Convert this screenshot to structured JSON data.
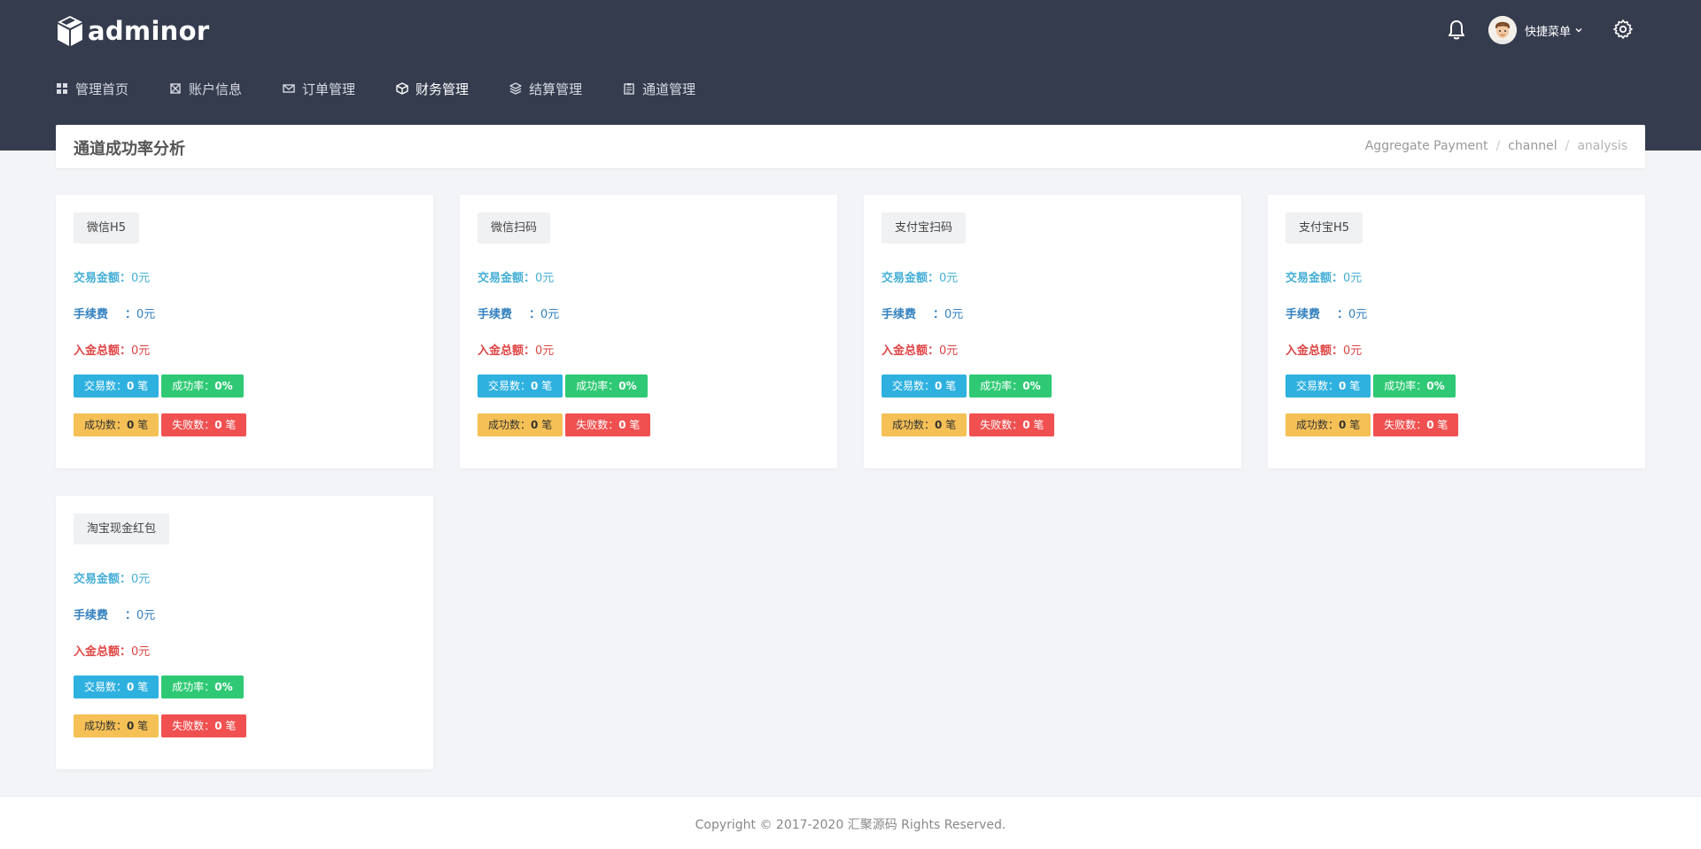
{
  "brand": {
    "name": "adminor"
  },
  "header": {
    "user_menu_label": "快捷菜单"
  },
  "nav": {
    "items": [
      {
        "label": "管理首页",
        "icon": "dashboard-icon",
        "active": false
      },
      {
        "label": "账户信息",
        "icon": "account-icon",
        "active": false
      },
      {
        "label": "订单管理",
        "icon": "mail-icon",
        "active": false
      },
      {
        "label": "财务管理",
        "icon": "cube-icon",
        "active": true
      },
      {
        "label": "结算管理",
        "icon": "layers-icon",
        "active": false
      },
      {
        "label": "通道管理",
        "icon": "clipboard-icon",
        "active": false
      }
    ]
  },
  "page": {
    "title": "通道成功率分析",
    "breadcrumb": [
      "Aggregate Payment",
      "channel",
      "analysis"
    ]
  },
  "labels": {
    "trade_amount": "交易金额：",
    "fee": "手续费",
    "fee_colon": "：",
    "income_total": "入金总额：",
    "trade_count": "交易数：",
    "success_rate": "成功率：",
    "success_count": "成功数：",
    "fail_count": "失败数：",
    "count_unit": "笔"
  },
  "channels": [
    {
      "name": "微信H5",
      "trade_amount": "0元",
      "fee": "0元",
      "income_total": "0元",
      "trade_count": "0",
      "success_rate": "0%",
      "success_count": "0",
      "fail_count": "0"
    },
    {
      "name": "微信扫码",
      "trade_amount": "0元",
      "fee": "0元",
      "income_total": "0元",
      "trade_count": "0",
      "success_rate": "0%",
      "success_count": "0",
      "fail_count": "0"
    },
    {
      "name": "支付宝扫码",
      "trade_amount": "0元",
      "fee": "0元",
      "income_total": "0元",
      "trade_count": "0",
      "success_rate": "0%",
      "success_count": "0",
      "fail_count": "0"
    },
    {
      "name": "支付宝H5",
      "trade_amount": "0元",
      "fee": "0元",
      "income_total": "0元",
      "trade_count": "0",
      "success_rate": "0%",
      "success_count": "0",
      "fail_count": "0"
    },
    {
      "name": "淘宝现金红包",
      "trade_amount": "0元",
      "fee": "0元",
      "income_total": "0元",
      "trade_count": "0",
      "success_rate": "0%",
      "success_count": "0",
      "fail_count": "0"
    }
  ],
  "footer": {
    "copyright": "Copyright © 2017-2020 汇聚源码 Rights Reserved."
  },
  "colors": {
    "topbar": "#353c4e",
    "amount": "#45aed6",
    "fee": "#3381bf",
    "income": "#e04545",
    "badge_blue": "#2fb1e0",
    "badge_green": "#2fc975",
    "badge_yellow": "#f5c055",
    "badge_red": "#f05050"
  }
}
